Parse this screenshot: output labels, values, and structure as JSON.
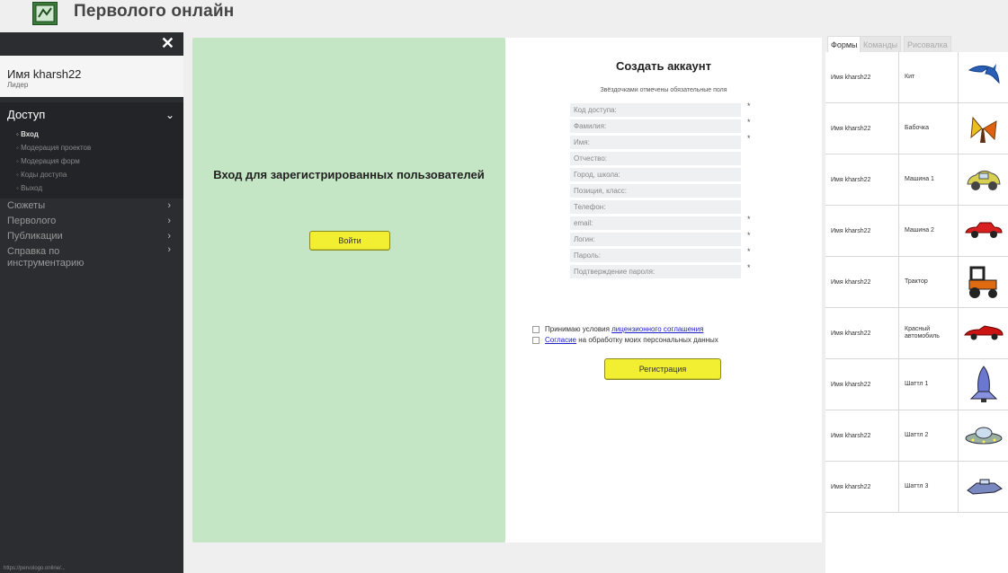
{
  "app": {
    "title": "Перволого онлайн"
  },
  "sidebar": {
    "close_glyph": "✕",
    "user": {
      "name": "Имя kharsh22",
      "role": "Лидер"
    },
    "access": {
      "label": "Доступ",
      "items": [
        {
          "label": "Вход",
          "active": true
        },
        {
          "label": "Модерация проектов",
          "active": false
        },
        {
          "label": "Модерация форм",
          "active": false
        },
        {
          "label": "Коды доступа",
          "active": false
        },
        {
          "label": "Выход",
          "active": false
        }
      ]
    },
    "menu": [
      {
        "label": "Сюжеты"
      },
      {
        "label": "Перволого"
      },
      {
        "label": "Публикации"
      },
      {
        "label": "Справка по инструментарию"
      }
    ],
    "status_url": "https://pervologo.online/..."
  },
  "login": {
    "title": "Вход для зарегистрированных пользователей",
    "button": "Войти"
  },
  "register": {
    "title": "Создать аккаунт",
    "note": "Звёздочками отмечены обязательные поля",
    "fields": [
      {
        "placeholder": "Код доступа:",
        "required": "*"
      },
      {
        "placeholder": "Фамилия:",
        "required": "*"
      },
      {
        "placeholder": "Имя:",
        "required": "*"
      },
      {
        "placeholder": "Отчество:",
        "required": ""
      },
      {
        "placeholder": "Город, школа:",
        "required": ""
      },
      {
        "placeholder": "Позиция, класс:",
        "required": ""
      },
      {
        "placeholder": "Телефон:",
        "required": ""
      },
      {
        "placeholder": "email:",
        "required": "*"
      },
      {
        "placeholder": "Логин:",
        "required": "*"
      },
      {
        "placeholder": "Пароль:",
        "required": "*"
      },
      {
        "placeholder": "Подтверждение пароля:",
        "required": "*"
      }
    ],
    "check1_prefix": "Принимаю условия ",
    "check1_link": "лицензионного соглашения",
    "check2_link": "Согласие",
    "check2_suffix": " на обработку моих персональных данных",
    "button": "Регистрация"
  },
  "right_panel": {
    "tabs": [
      {
        "label": "Формы",
        "active": true
      },
      {
        "label": "Команды",
        "active": false
      },
      {
        "label": "Рисовалка",
        "active": false
      }
    ],
    "rows": [
      {
        "owner": "Имя kharsh22",
        "name": "Кит",
        "icon": "dolphin-icon"
      },
      {
        "owner": "Имя kharsh22",
        "name": "Бабочка",
        "icon": "butterfly-icon"
      },
      {
        "owner": "Имя kharsh22",
        "name": "Машина 1",
        "icon": "car-yellow-icon"
      },
      {
        "owner": "Имя kharsh22",
        "name": "Машина 2",
        "icon": "car-red-icon"
      },
      {
        "owner": "Имя kharsh22",
        "name": "Трактор",
        "icon": "tractor-icon"
      },
      {
        "owner": "Имя kharsh22",
        "name": "Красный автомобиль",
        "icon": "sports-car-icon"
      },
      {
        "owner": "Имя kharsh22",
        "name": "Шаттл 1",
        "icon": "shuttle-icon"
      },
      {
        "owner": "Имя kharsh22",
        "name": "Шаттл 2",
        "icon": "ufo-icon"
      },
      {
        "owner": "Имя kharsh22",
        "name": "Шаттл 3",
        "icon": "spaceship-icon"
      }
    ]
  }
}
